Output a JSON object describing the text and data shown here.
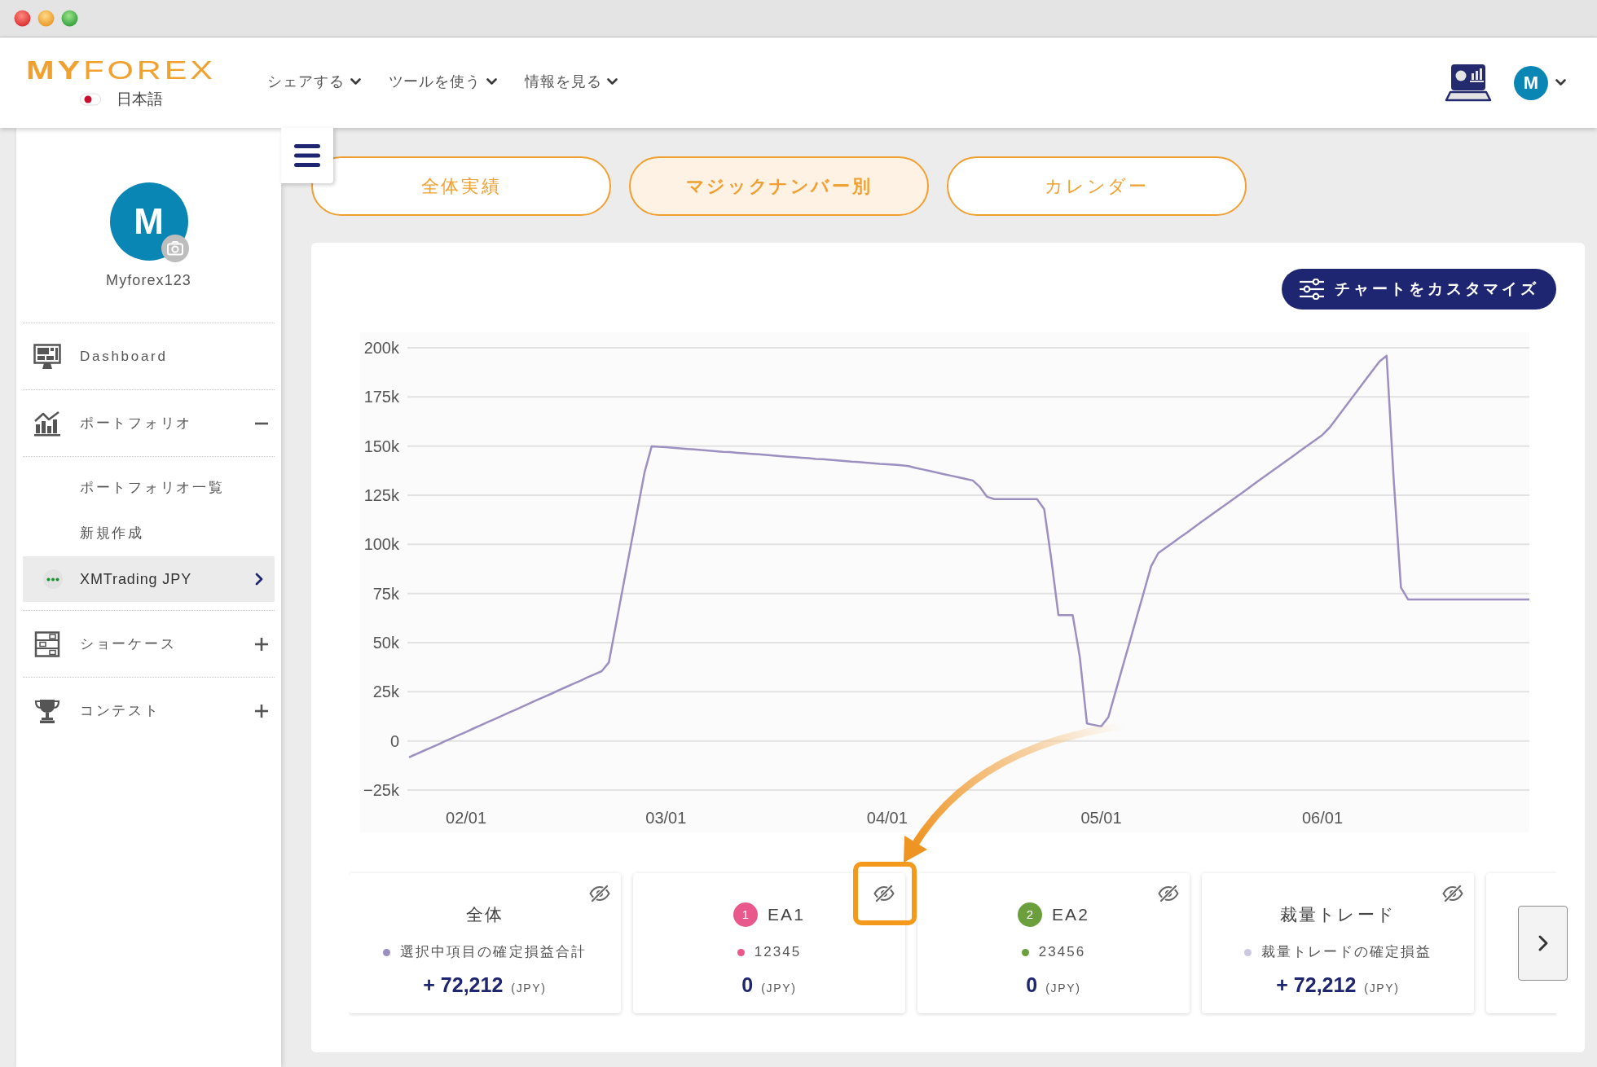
{
  "header": {
    "logo": "**MY**FOREX",
    "language": "日本語",
    "nav": [
      {
        "label": "シェアする"
      },
      {
        "label": "ツールを使う"
      },
      {
        "label": "情報を見る"
      }
    ],
    "user_initial": "M"
  },
  "sidebar": {
    "profile": {
      "initial": "M",
      "username": "Myforex123"
    },
    "items": [
      {
        "kind": "link",
        "label": "Dashboard",
        "selected": false
      },
      {
        "kind": "group",
        "label": "ポートフォリオ",
        "selected": false,
        "expanded": true,
        "children": [
          {
            "kind": "link",
            "label": "ポートフォリオ一覧",
            "selected": false
          },
          {
            "kind": "link",
            "label": "新規作成",
            "selected": false
          },
          {
            "kind": "account",
            "label": "XMTrading JPY",
            "selected": true
          }
        ]
      },
      {
        "kind": "group",
        "label": "ショーケース",
        "selected": false,
        "expanded": false
      },
      {
        "kind": "group",
        "label": "コンテスト",
        "selected": false,
        "expanded": false
      }
    ]
  },
  "main": {
    "tabs": [
      {
        "label": "全体実績",
        "selected": false
      },
      {
        "label": "マジックナンバー別",
        "selected": true
      },
      {
        "label": "カレンダー",
        "selected": false
      }
    ],
    "customize_button": "チャートをカスタマイズ",
    "chart_data": {
      "type": "line",
      "grid": true,
      "categories": [
        null,
        null,
        null,
        null,
        null,
        null,
        null,
        null,
        "02/01",
        null,
        null,
        null,
        null,
        null,
        null,
        null,
        null,
        null,
        null,
        null,
        null,
        null,
        null,
        null,
        null,
        null,
        null,
        null,
        null,
        null,
        null,
        null,
        null,
        null,
        null,
        null,
        "03/01",
        null,
        null,
        null,
        null,
        null,
        null,
        null,
        null,
        null,
        null,
        null,
        null,
        null,
        null,
        null,
        null,
        null,
        null,
        null,
        null,
        null,
        null,
        null,
        null,
        null,
        null,
        null,
        null,
        null,
        null,
        "04/01",
        null,
        null,
        null,
        null,
        null,
        null,
        null,
        null,
        null,
        null,
        null,
        null,
        null,
        null,
        null,
        null,
        null,
        null,
        null,
        null,
        null,
        null,
        null,
        null,
        null,
        null,
        null,
        null,
        null,
        "05/01",
        null,
        null,
        null,
        null,
        null,
        null,
        null,
        null,
        null,
        null,
        null,
        null,
        null,
        null,
        null,
        null,
        null,
        null,
        null,
        null,
        null,
        null,
        null,
        null,
        null,
        null,
        null,
        null,
        null,
        null,
        "06/01",
        null,
        null,
        null,
        null,
        null,
        null,
        null,
        null,
        null,
        null,
        null,
        null,
        null,
        null,
        null,
        null,
        null,
        null,
        null,
        null,
        null,
        null,
        null,
        null,
        null,
        null,
        null,
        null,
        null
      ],
      "series": [
        {
          "color": "#9d8fc0",
          "values": [
            -8400,
            -6700,
            -5100,
            -3500,
            -1900,
            -200,
            1400,
            3000,
            4600,
            6300,
            7900,
            9500,
            11100,
            12800,
            14400,
            16000,
            17600,
            19300,
            20900,
            22500,
            24100,
            25800,
            27400,
            29000,
            30600,
            32300,
            33900,
            35500,
            39900,
            59200,
            78500,
            97800,
            117200,
            136500,
            149900,
            149600,
            149400,
            149100,
            148800,
            148500,
            148300,
            148000,
            147700,
            147400,
            147100,
            146900,
            146600,
            146300,
            146000,
            145800,
            145500,
            145200,
            144900,
            144600,
            144400,
            144100,
            143800,
            143500,
            143300,
            143000,
            142700,
            142400,
            142100,
            141900,
            141600,
            141300,
            141000,
            140800,
            140500,
            140200,
            139800,
            138900,
            138100,
            137300,
            136500,
            135700,
            134900,
            134100,
            133300,
            132500,
            129200,
            124200,
            123000,
            123000,
            123000,
            123000,
            123000,
            123000,
            123000,
            118000,
            92600,
            64000,
            64000,
            64000,
            42800,
            8900,
            8100,
            7400,
            12100,
            24900,
            37700,
            50500,
            63300,
            76100,
            88900,
            95600,
            98200,
            100800,
            103400,
            106000,
            108600,
            111300,
            113900,
            116500,
            119100,
            121700,
            124300,
            126900,
            129600,
            132200,
            134800,
            137400,
            140000,
            142600,
            145200,
            147900,
            150500,
            153100,
            155700,
            159400,
            164200,
            169000,
            173900,
            178700,
            183500,
            188300,
            193100,
            196000,
            132300,
            78000,
            72000,
            72000,
            72000,
            72000,
            72000,
            72000,
            72000,
            72000,
            72000,
            72000,
            72000,
            72000,
            72000,
            72000,
            72000,
            72000,
            72000,
            72000
          ]
        }
      ],
      "ylim": [
        -25000,
        200000
      ],
      "yticks": [
        {
          "value": 200000,
          "label": "200k"
        },
        {
          "value": 175000,
          "label": "175k"
        },
        {
          "value": 150000,
          "label": "150k"
        },
        {
          "value": 125000,
          "label": "125k"
        },
        {
          "value": 100000,
          "label": "100k"
        },
        {
          "value": 75000,
          "label": "75k"
        },
        {
          "value": 50000,
          "label": "50k"
        },
        {
          "value": 25000,
          "label": "25k"
        },
        {
          "value": 0,
          "label": "0"
        },
        {
          "value": -25000,
          "label": "−25k"
        }
      ]
    },
    "cards": [
      {
        "title": "全体",
        "color": "#9b8fc2",
        "subtitle": "選択中項目の確定損益合計",
        "value": "+ 72,212",
        "unit": "(JPY)"
      },
      {
        "badge": "1",
        "title": "EA1",
        "color": "#e9588b",
        "subtitle": "12345",
        "value": "0",
        "unit": "(JPY)"
      },
      {
        "badge": "2",
        "title": "EA2",
        "color": "#6b9e3c",
        "subtitle": "23456",
        "value": "0",
        "unit": "(JPY)"
      },
      {
        "title": "裁量トレード",
        "color": "#cdc7e0",
        "subtitle": "裁量トレードの確定損益",
        "value": "+ 72,212",
        "unit": "(JPY)"
      }
    ]
  }
}
